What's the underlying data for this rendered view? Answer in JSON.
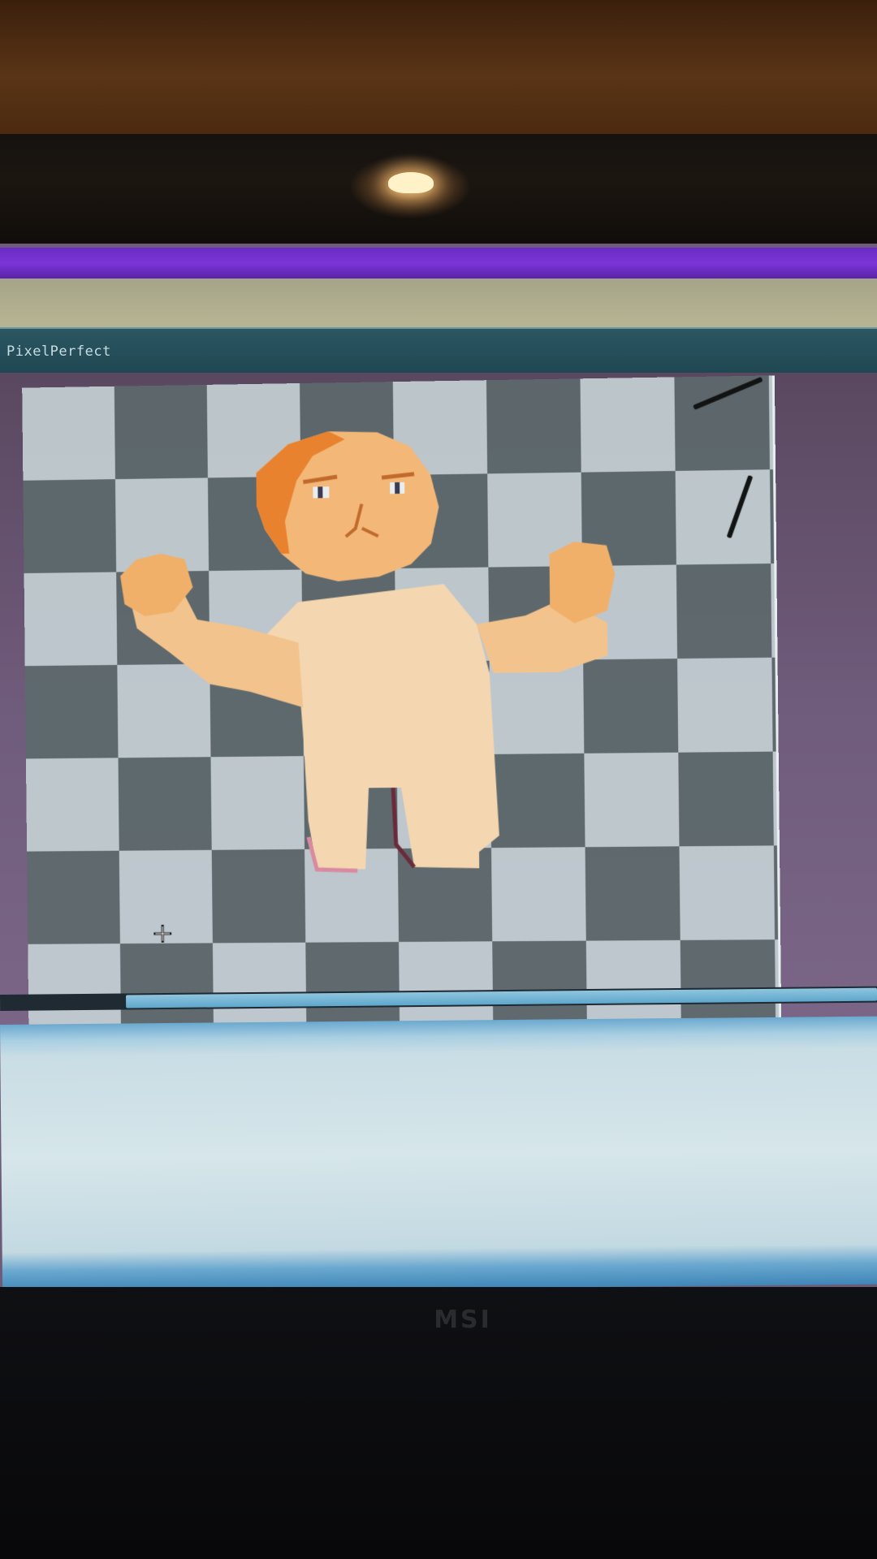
{
  "window": {
    "title": "PixelPerfect"
  },
  "bezel": {
    "brand": "MSI"
  },
  "colors": {
    "taskbar": "#7b34d8",
    "titlebar": "#1f4752",
    "workspace": "#6f5b7b",
    "checker_light": "#c4d0d3",
    "checker_dark": "#5d6a6c",
    "skin": "#f2c89a",
    "hair": "#e9822e",
    "scrollbar": "#5ea7cc"
  },
  "icons": {
    "cursor": "crosshair-cursor-icon"
  },
  "scroll": {
    "horizontal_position": 0.15
  }
}
